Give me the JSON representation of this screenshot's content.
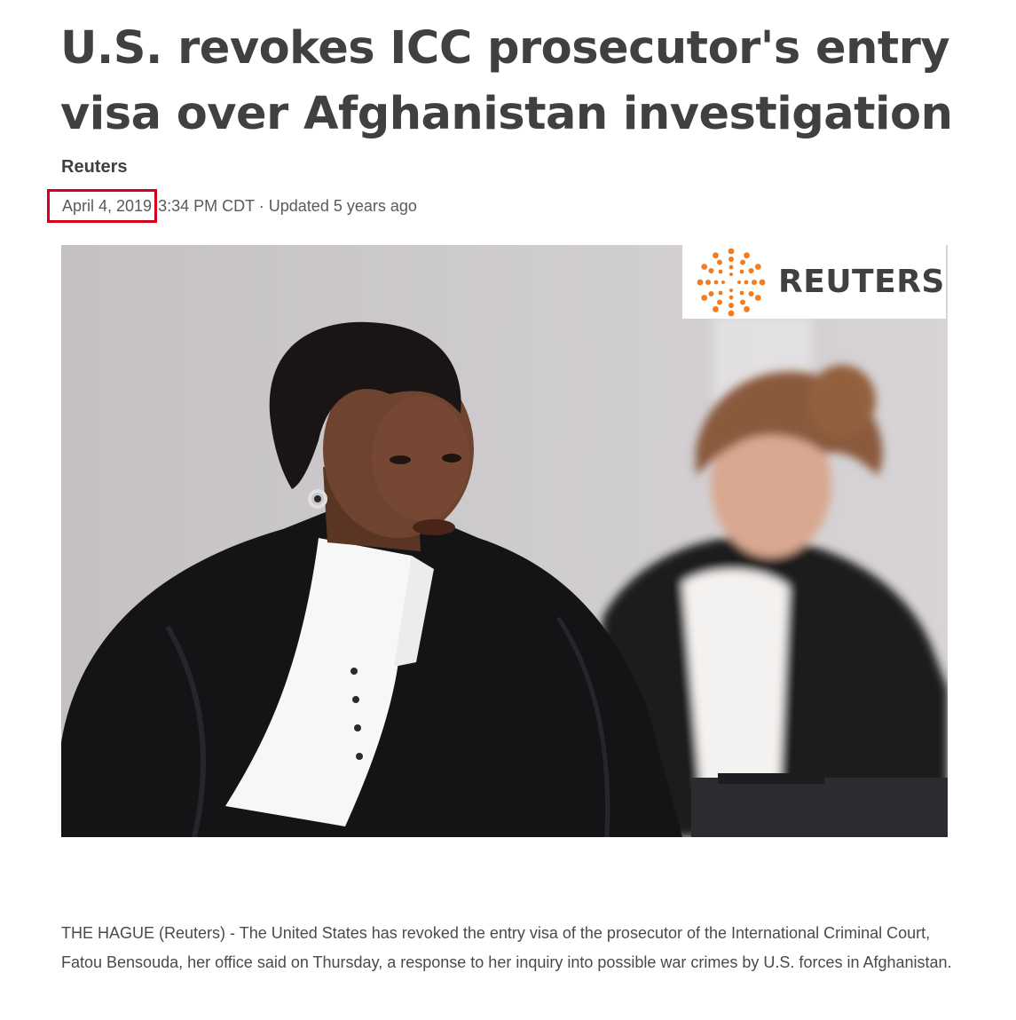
{
  "article": {
    "headline": "U.S. revokes ICC prosecutor's entry visa over Afghanistan investigation",
    "byline": "Reuters",
    "date": "April 4, 2019",
    "time_and_update": "3:34 PM CDT · Updated 5 years ago",
    "body": "THE HAGUE (Reuters) - The United States has revoked the entry visa of the prosecutor of the International Criminal Court, Fatou Bensouda, her office said on Thursday, a response to her inquiry into possible war crimes by U.S. forces in Afghanistan."
  },
  "photo": {
    "watermark": "REUTERS",
    "logo_icon": "reuters-dot-ring-logo"
  },
  "colors": {
    "highlight_box": "#d6001c",
    "logo_orange": "#f47c20",
    "text": "#404040"
  }
}
